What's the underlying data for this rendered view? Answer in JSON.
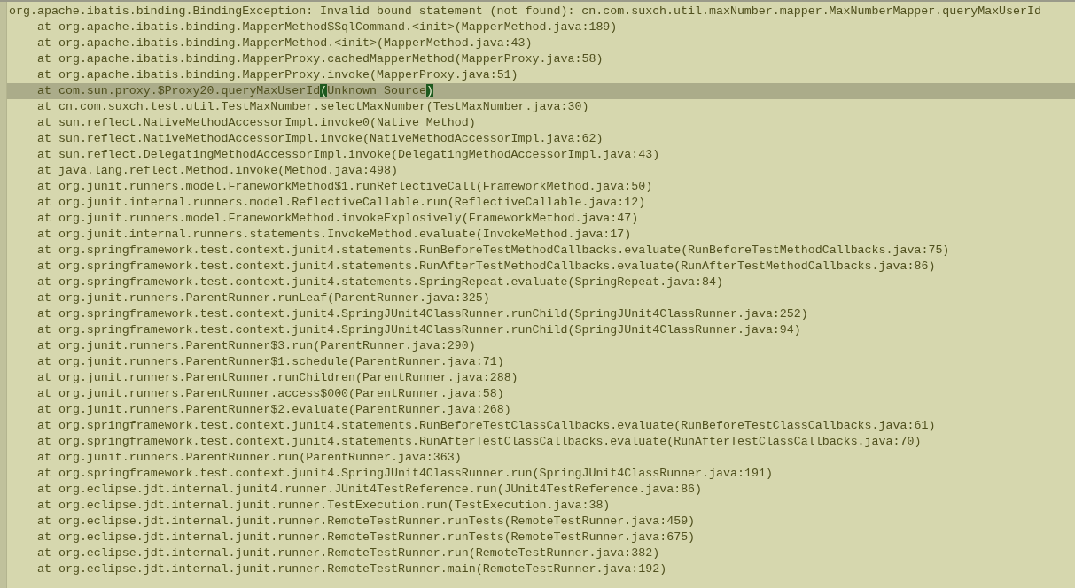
{
  "console": {
    "exception": "org.apache.ibatis.binding.BindingException: Invalid bound statement (not found): cn.com.suxch.util.maxNumber.mapper.MaxNumberMapper.queryMaxUserId",
    "frames": [
      {
        "text": "at org.apache.ibatis.binding.MapperMethod$SqlCommand.<init>(MapperMethod.java:189)",
        "selected": false,
        "bracket_match": false
      },
      {
        "text": "at org.apache.ibatis.binding.MapperMethod.<init>(MapperMethod.java:43)",
        "selected": false,
        "bracket_match": false
      },
      {
        "text": "at org.apache.ibatis.binding.MapperProxy.cachedMapperMethod(MapperProxy.java:58)",
        "selected": false,
        "bracket_match": false
      },
      {
        "text": "at org.apache.ibatis.binding.MapperProxy.invoke(MapperProxy.java:51)",
        "selected": false,
        "bracket_match": false
      },
      {
        "text": "at com.sun.proxy.$Proxy20.queryMaxUserId(Unknown Source)",
        "selected": true,
        "bracket_match": true
      },
      {
        "text": "at cn.com.suxch.test.util.TestMaxNumber.selectMaxNumber(TestMaxNumber.java:30)",
        "selected": false,
        "bracket_match": false
      },
      {
        "text": "at sun.reflect.NativeMethodAccessorImpl.invoke0(Native Method)",
        "selected": false,
        "bracket_match": false
      },
      {
        "text": "at sun.reflect.NativeMethodAccessorImpl.invoke(NativeMethodAccessorImpl.java:62)",
        "selected": false,
        "bracket_match": false
      },
      {
        "text": "at sun.reflect.DelegatingMethodAccessorImpl.invoke(DelegatingMethodAccessorImpl.java:43)",
        "selected": false,
        "bracket_match": false
      },
      {
        "text": "at java.lang.reflect.Method.invoke(Method.java:498)",
        "selected": false,
        "bracket_match": false
      },
      {
        "text": "at org.junit.runners.model.FrameworkMethod$1.runReflectiveCall(FrameworkMethod.java:50)",
        "selected": false,
        "bracket_match": false
      },
      {
        "text": "at org.junit.internal.runners.model.ReflectiveCallable.run(ReflectiveCallable.java:12)",
        "selected": false,
        "bracket_match": false
      },
      {
        "text": "at org.junit.runners.model.FrameworkMethod.invokeExplosively(FrameworkMethod.java:47)",
        "selected": false,
        "bracket_match": false
      },
      {
        "text": "at org.junit.internal.runners.statements.InvokeMethod.evaluate(InvokeMethod.java:17)",
        "selected": false,
        "bracket_match": false
      },
      {
        "text": "at org.springframework.test.context.junit4.statements.RunBeforeTestMethodCallbacks.evaluate(RunBeforeTestMethodCallbacks.java:75)",
        "selected": false,
        "bracket_match": false
      },
      {
        "text": "at org.springframework.test.context.junit4.statements.RunAfterTestMethodCallbacks.evaluate(RunAfterTestMethodCallbacks.java:86)",
        "selected": false,
        "bracket_match": false
      },
      {
        "text": "at org.springframework.test.context.junit4.statements.SpringRepeat.evaluate(SpringRepeat.java:84)",
        "selected": false,
        "bracket_match": false
      },
      {
        "text": "at org.junit.runners.ParentRunner.runLeaf(ParentRunner.java:325)",
        "selected": false,
        "bracket_match": false
      },
      {
        "text": "at org.springframework.test.context.junit4.SpringJUnit4ClassRunner.runChild(SpringJUnit4ClassRunner.java:252)",
        "selected": false,
        "bracket_match": false
      },
      {
        "text": "at org.springframework.test.context.junit4.SpringJUnit4ClassRunner.runChild(SpringJUnit4ClassRunner.java:94)",
        "selected": false,
        "bracket_match": false
      },
      {
        "text": "at org.junit.runners.ParentRunner$3.run(ParentRunner.java:290)",
        "selected": false,
        "bracket_match": false
      },
      {
        "text": "at org.junit.runners.ParentRunner$1.schedule(ParentRunner.java:71)",
        "selected": false,
        "bracket_match": false
      },
      {
        "text": "at org.junit.runners.ParentRunner.runChildren(ParentRunner.java:288)",
        "selected": false,
        "bracket_match": false
      },
      {
        "text": "at org.junit.runners.ParentRunner.access$000(ParentRunner.java:58)",
        "selected": false,
        "bracket_match": false
      },
      {
        "text": "at org.junit.runners.ParentRunner$2.evaluate(ParentRunner.java:268)",
        "selected": false,
        "bracket_match": false
      },
      {
        "text": "at org.springframework.test.context.junit4.statements.RunBeforeTestClassCallbacks.evaluate(RunBeforeTestClassCallbacks.java:61)",
        "selected": false,
        "bracket_match": false
      },
      {
        "text": "at org.springframework.test.context.junit4.statements.RunAfterTestClassCallbacks.evaluate(RunAfterTestClassCallbacks.java:70)",
        "selected": false,
        "bracket_match": false
      },
      {
        "text": "at org.junit.runners.ParentRunner.run(ParentRunner.java:363)",
        "selected": false,
        "bracket_match": false
      },
      {
        "text": "at org.springframework.test.context.junit4.SpringJUnit4ClassRunner.run(SpringJUnit4ClassRunner.java:191)",
        "selected": false,
        "bracket_match": false
      },
      {
        "text": "at org.eclipse.jdt.internal.junit4.runner.JUnit4TestReference.run(JUnit4TestReference.java:86)",
        "selected": false,
        "bracket_match": false
      },
      {
        "text": "at org.eclipse.jdt.internal.junit.runner.TestExecution.run(TestExecution.java:38)",
        "selected": false,
        "bracket_match": false
      },
      {
        "text": "at org.eclipse.jdt.internal.junit.runner.RemoteTestRunner.runTests(RemoteTestRunner.java:459)",
        "selected": false,
        "bracket_match": false
      },
      {
        "text": "at org.eclipse.jdt.internal.junit.runner.RemoteTestRunner.runTests(RemoteTestRunner.java:675)",
        "selected": false,
        "bracket_match": false
      },
      {
        "text": "at org.eclipse.jdt.internal.junit.runner.RemoteTestRunner.run(RemoteTestRunner.java:382)",
        "selected": false,
        "bracket_match": false
      },
      {
        "text": "at org.eclipse.jdt.internal.junit.runner.RemoteTestRunner.main(RemoteTestRunner.java:192)",
        "selected": false,
        "bracket_match": false
      }
    ]
  }
}
